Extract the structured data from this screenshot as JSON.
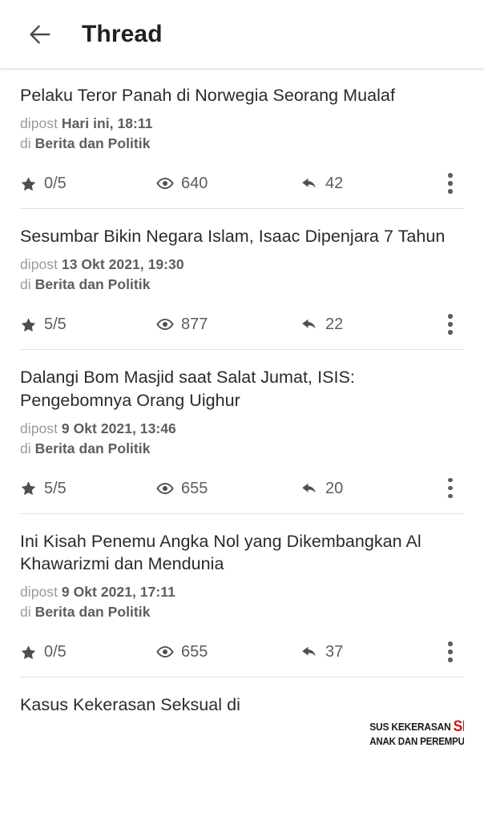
{
  "appbar": {
    "back_icon": "arrow-left-icon",
    "title": "Thread"
  },
  "stat_icons": {
    "rating": "star-icon",
    "views": "eye-icon",
    "replies": "reply-arrow-icon",
    "overflow": "more-vertical-icon"
  },
  "labels": {
    "posted_prefix": "dipost",
    "in_prefix": "di"
  },
  "threads": [
    {
      "title": "Pelaku Teror Panah di Norwegia Seorang Mualaf",
      "posted_prefix": "dipost",
      "posted_at": "Hari ini, 18:11",
      "in_prefix": "di",
      "category": "Berita dan Politik",
      "rating": "0/5",
      "views": "640",
      "replies": "42",
      "has_thumbnail": false
    },
    {
      "title": "Sesumbar Bikin Negara Islam, Isaac Dipenjara 7 Tahun",
      "posted_prefix": "dipost",
      "posted_at": "13 Okt 2021, 19:30",
      "in_prefix": "di",
      "category": "Berita dan Politik",
      "rating": "5/5",
      "views": "877",
      "replies": "22",
      "has_thumbnail": false
    },
    {
      "title": "Dalangi Bom Masjid saat Salat Jumat, ISIS: Pengebomnya Orang Uighur",
      "posted_prefix": "dipost",
      "posted_at": "9 Okt 2021, 13:46",
      "in_prefix": "di",
      "category": "Berita dan Politik",
      "rating": "5/5",
      "views": "655",
      "replies": "20",
      "has_thumbnail": false
    },
    {
      "title": "Ini Kisah Penemu Angka Nol yang Dikembangkan Al Khawarizmi dan Mendunia",
      "posted_prefix": "dipost",
      "posted_at": "9 Okt 2021, 17:11",
      "in_prefix": "di",
      "category": "Berita dan Politik",
      "rating": "0/5",
      "views": "655",
      "replies": "37",
      "has_thumbnail": false
    },
    {
      "title": "Kasus Kekerasan Seksual di",
      "has_thumbnail": true,
      "thumbnail_line1_prefix": "SUS KEKERASAN ",
      "thumbnail_line1_highlight": "SEKSU",
      "thumbnail_line2": "ANAK DAN PEREMPUAN:",
      "partial": true
    }
  ],
  "colors": {
    "title_text": "#2a2a2a",
    "meta_light": "#9a9a9a",
    "meta_bold": "#5d5d5d",
    "divider": "#e2e2e2",
    "appbar_title": "#212121",
    "thumb_highlight": "#d41212",
    "background": "#ffffff"
  }
}
